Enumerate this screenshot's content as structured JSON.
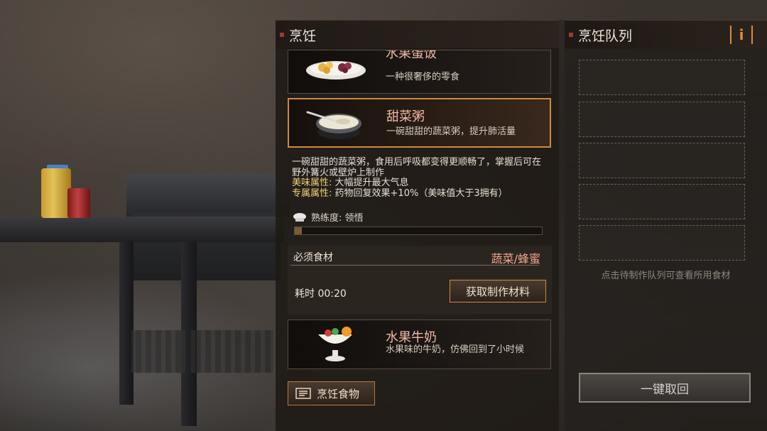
{
  "cooking_panel": {
    "title": "烹饪",
    "recipes": [
      {
        "name": "水果蛋饭",
        "desc": "一种很奢侈的零食"
      },
      {
        "name": "甜菜粥",
        "desc": "一碗甜甜的蔬菜粥，提升肺活量"
      },
      {
        "name": "水果牛奶",
        "desc": "水果味的牛奶，仿佛回到了小时候"
      }
    ],
    "detail": {
      "description": "一碗甜甜的蔬菜粥，食用后呼吸都变得更顺畅了，掌握后可在野外篝火或壁炉上制作",
      "flavor_label": "美味属性:",
      "flavor_value": "大幅提升最大气息",
      "exclusive_label": "专属属性:",
      "exclusive_value": "药物回复效果+10%（美味值大于3拥有）",
      "proficiency": "熟练度: 领悟",
      "proficiency_progress": 0.03
    },
    "required": {
      "label": "必须食材",
      "value": "蔬菜/蜂蜜"
    },
    "time": "耗时 00:20",
    "get_materials_button": "获取制作材料",
    "cook_food_button": "烹饪食物"
  },
  "queue_panel": {
    "title": "烹饪队列",
    "info_button": "i",
    "hint": "点击待制作队列可查看所用食材",
    "recall_button": "一键取回"
  },
  "colors": {
    "accent": "#d08a3e",
    "recipe_name": "#f2b8a6",
    "attribute_label": "#f0d078",
    "info": "#e08a3a"
  }
}
